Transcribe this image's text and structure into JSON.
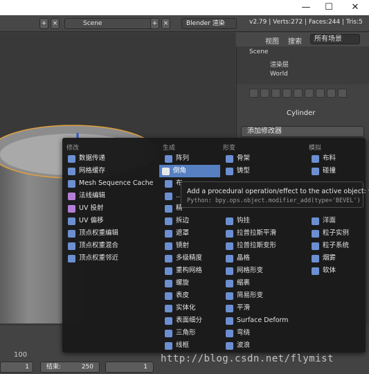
{
  "window": {
    "minimize": "—",
    "maximize": "☐",
    "close": "✕"
  },
  "header": {
    "scene_field": "Scene",
    "render_engine": "Blender 渲染",
    "stats": "v2.79 | Verts:272 | Faces:244 | Tris:5"
  },
  "outliner": {
    "view_label": "视图",
    "search_label": "搜索",
    "filter": "所有场景",
    "rows": [
      "Scene",
      "渲染层",
      "World"
    ]
  },
  "properties": {
    "object_name": "Cylinder",
    "add_modifier": "添加修改器"
  },
  "menu": {
    "columns": [
      "修改",
      "生成",
      "形变",
      "模拟"
    ],
    "modify": [
      "数据传递",
      "网格缓存",
      "Mesh Sequence Cache",
      "法线编辑",
      "UV 投射",
      "UV 偏移",
      "顶点权重编辑",
      "顶点权重混合",
      "顶点权重邻近"
    ],
    "generate": [
      "阵列",
      "倒角",
      "布",
      "...",
      "精",
      "拆边",
      "遮罩",
      "镜射",
      "多级精度",
      "重构网格",
      "螺旋",
      "表皮",
      "实体化",
      "表面细分",
      "三角形",
      "线框"
    ],
    "deform": [
      "骨架",
      "铸型",
      "",
      "",
      "",
      "钩挂",
      "拉普拉斯平滑",
      "拉普拉斯变形",
      "晶格",
      "网格形变",
      "缩裹",
      "简易形变",
      "平滑",
      "Surface Deform",
      "弯绕",
      "波浪"
    ],
    "simulate": [
      "布料",
      "碰撞",
      "",
      "",
      "",
      "洋面",
      "粒子实例",
      "粒子系统",
      "烟雾",
      "软体"
    ]
  },
  "tooltip": {
    "text": "Add a procedural operation/effect to the active object:",
    "highlight": "倒角",
    "python": "Python: bpy.ops.object.modifier_add(type='BEVEL')"
  },
  "timeline": {
    "frame_100": "100",
    "start_value": "1",
    "end_label": "结束:",
    "end_value": "250",
    "current_value": "1"
  },
  "watermark": "http://blog.csdn.net/flymist"
}
